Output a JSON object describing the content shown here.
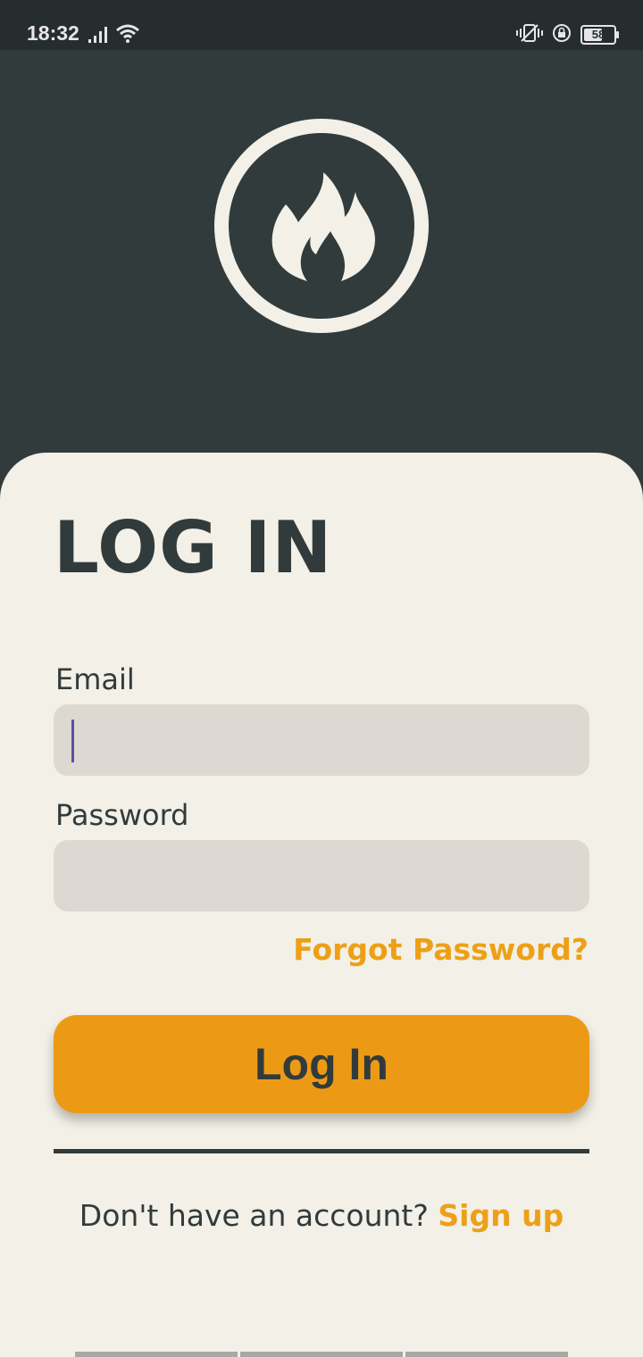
{
  "status_bar": {
    "time": "18:32",
    "battery_level": "58",
    "icons": [
      "signal-icon",
      "wifi-icon",
      "vibrate-icon",
      "rotation-lock-icon",
      "battery-icon"
    ]
  },
  "app": {
    "logo_icon": "flame-icon",
    "title": "LOG IN"
  },
  "form": {
    "email_label": "Email",
    "email_value": "",
    "password_label": "Password",
    "password_value": "",
    "forgot_password": "Forgot Password?",
    "login_button": "Log In",
    "no_account_text": "Don't have an account?",
    "signup_link": "Sign up"
  },
  "colors": {
    "background_dark": "#323B3B",
    "card_background": "#F2F0E7",
    "accent": "#EC9A16",
    "input_background": "#DDD9D2"
  }
}
